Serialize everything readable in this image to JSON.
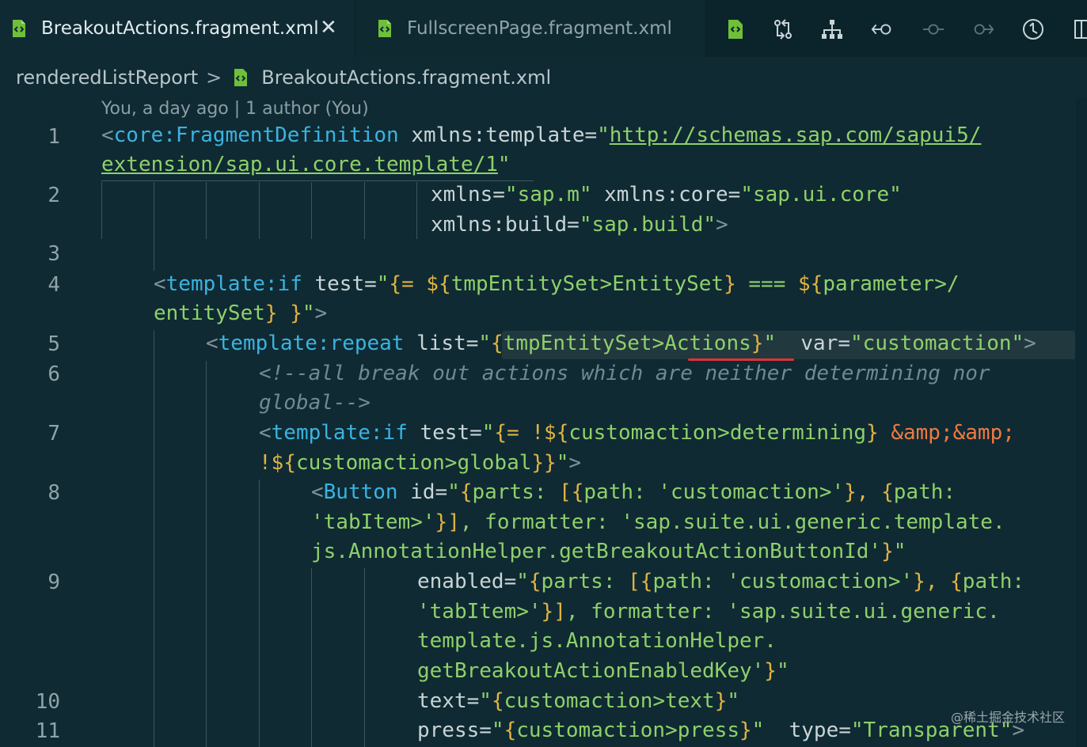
{
  "tabs": [
    {
      "label": "BreakoutActions.fragment.xml",
      "active": true,
      "icon": "xml-file-icon"
    },
    {
      "label": "FullscreenPage.fragment.xml",
      "active": false,
      "icon": "xml-file-icon"
    }
  ],
  "toolbar_icons": [
    "open-preview-icon",
    "git-compare-icon",
    "hierarchy-icon",
    "go-back-icon",
    "timeline-dot-icon",
    "go-forward-icon",
    "history-icon",
    "split-editor-icon"
  ],
  "breadcrumb": {
    "folder": "renderedListReport",
    "separator": ">",
    "file": "BreakoutActions.fragment.xml"
  },
  "blame": "You, a day ago | 1 author (You)",
  "line_numbers": [
    "1",
    "2",
    "3",
    "4",
    "5",
    "6",
    "7",
    "8",
    "9",
    "10",
    "11"
  ],
  "code": {
    "l1a_open": "<",
    "l1a_tag": "core:FragmentDefinition",
    "l1a_attr": " xmlns:template=",
    "l1a_q": "\"",
    "l1a_url": "http://schemas.sap.com/sapui5/",
    "l1b_url": "extension/sap.ui.core.template/1",
    "l1b_q": "\"",
    "l2a_attr1": "xmlns=",
    "l2a_val1": "\"sap.m\"",
    "l2a_attr2": " xmlns:core=",
    "l2a_val2": "\"sap.ui.core\"",
    "l2b_attr": "xmlns:build=",
    "l2b_val": "\"sap.build\"",
    "l2b_close": ">",
    "l4a_open": "<",
    "l4a_tag": "template:if",
    "l4a_attr": " test=",
    "l4a_q": "\"",
    "l4a_brace": "{= ${",
    "l4a_v1": "tmpEntitySet>EntitySet",
    "l4a_b2": "}",
    "l4a_op": " === ",
    "l4a_b3": "${",
    "l4a_v2": "parameter>/",
    "l4b_v": "entitySet",
    "l4b_b": "} }",
    "l4b_q": "\"",
    "l4b_close": ">",
    "l5_open": "<",
    "l5_tag": "template:repeat",
    "l5_attr": " list=",
    "l5_q": "\"",
    "l5_b1": "{",
    "l5_v": "tmpEntitySet>Actions",
    "l5_b2": "}",
    "l5_q2": "\"",
    "l5_attr2": "  var=",
    "l5_val2": "\"customaction\"",
    "l5_close": ">",
    "l6a": "<!--all break out actions which are neither determining nor",
    "l6b": "global-->",
    "l7a_open": "<",
    "l7a_tag": "template:if",
    "l7a_attr": " test=",
    "l7a_q": "\"",
    "l7a_b": "{= !${",
    "l7a_v": "customaction>determining",
    "l7a_b2": "}",
    "l7a_ent": " &amp;&amp;",
    "l7b_b": "!${",
    "l7b_v": "customaction>global",
    "l7b_b2": "}}",
    "l7b_q": "\"",
    "l7b_close": ">",
    "l8a_open": "<",
    "l8a_tag": "Button",
    "l8a_attr": " id=",
    "l8a_q": "\"",
    "l8a_b": "{",
    "l8a_s": "parts: ",
    "l8a_b2": "[{",
    "l8a_s2": "path: 'customaction>'",
    "l8a_b3": "}, {",
    "l8a_s3": "path:",
    "l8b_s": "'tabItem>'",
    "l8b_b": "}]",
    "l8b_s2": ", formatter: 'sap.suite.ui.generic.template.",
    "l8c_s": "js.AnnotationHelper.getBreakoutActionButtonId'",
    "l8c_b": "}",
    "l8c_q": "\"",
    "l9a_attr": "enabled=",
    "l9a_q": "\"",
    "l9a_b": "{",
    "l9a_s": "parts: ",
    "l9a_b2": "[{",
    "l9a_s2": "path: 'customaction>'",
    "l9a_b3": "}, {",
    "l9a_s3": "path:",
    "l9b_s": "'tabItem>'",
    "l9b_b": "}]",
    "l9b_s2": ", formatter: 'sap.suite.ui.generic.",
    "l9c_s": "template.js.AnnotationHelper.",
    "l9d_s": "getBreakoutActionEnabledKey'",
    "l9d_b": "}",
    "l9d_q": "\"",
    "l10_attr": "text=",
    "l10_q": "\"",
    "l10_b": "{",
    "l10_v": "customaction>text",
    "l10_b2": "}",
    "l10_q2": "\"",
    "l11_attr": "press=",
    "l11_q": "\"",
    "l11_b": "{",
    "l11_v": "customaction>press",
    "l11_b2": "}",
    "l11_q2": "\"",
    "l11_attr2": "  type=",
    "l11_val2": "\"Transparent\"",
    "l11_close": ">"
  },
  "watermark": "@稀土掘金技术社区",
  "colors": {
    "background": "#0f2a33",
    "tag": "#3bb3e0",
    "string": "#8fd06a",
    "operator": "#e0b341",
    "entity": "#f07a40",
    "error": "#e0323a"
  }
}
